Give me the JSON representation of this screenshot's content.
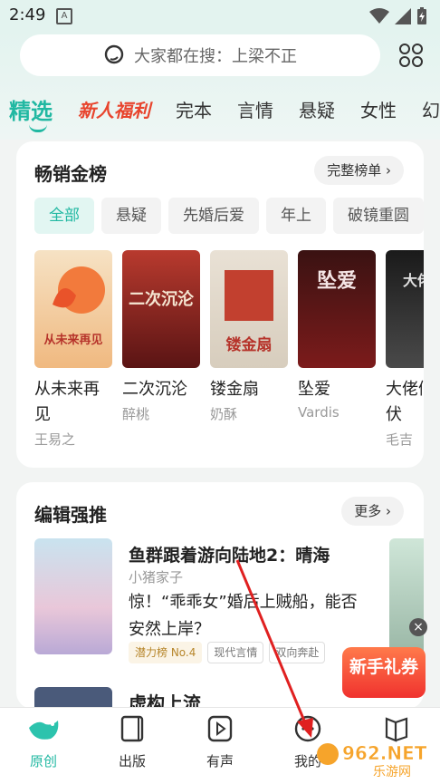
{
  "status": {
    "time": "2:49"
  },
  "search": {
    "placeholder": "大家都在搜：上梁不正"
  },
  "tabs": [
    "精选",
    "新人福利",
    "完本",
    "言情",
    "悬疑",
    "女性",
    "幻"
  ],
  "bestseller": {
    "title": "畅销金榜",
    "more": "完整榜单 ›",
    "filters": [
      "全部",
      "悬疑",
      "先婚后爱",
      "年上",
      "破镜重圆"
    ],
    "books": [
      {
        "title": "从未来再见",
        "author": "王易之",
        "cover_text": "从未来再见",
        "color": "#f2d9b5"
      },
      {
        "title": "二次沉沦",
        "author": "醉桃",
        "cover_text": "二次沉沦",
        "color": "#8b2a2a"
      },
      {
        "title": "镂金扇",
        "author": "奶酥",
        "cover_text": "镂金扇",
        "color": "#c2402f"
      },
      {
        "title": "坠爱",
        "author": "Vardis",
        "cover_text": "坠爱",
        "color": "#7c1b1b"
      },
      {
        "title": "大佬们在伏",
        "author": "毛吉",
        "cover_text": "大佬们",
        "color": "#2e2e2e"
      }
    ]
  },
  "editor": {
    "title": "编辑强推",
    "more": "更多 ›",
    "rec": {
      "title": "鱼群跟着游向陆地2：晴海",
      "author": "小猪家子",
      "desc": "惊！“乖乖女”婚后上贼船，能否安然上岸？",
      "tags": [
        "潜力榜 No.4",
        "现代言情",
        "双向奔赴"
      ]
    },
    "rec2_title": "虚构上流",
    "gift": "新手礼券",
    "gift_close": "×"
  },
  "nav": [
    {
      "label": "原创",
      "icon": "bird-icon"
    },
    {
      "label": "出版",
      "icon": "book-icon"
    },
    {
      "label": "有声",
      "icon": "play-icon"
    },
    {
      "label": "我的",
      "icon": "profile-icon"
    },
    {
      "label": "",
      "icon": "bookshelf-icon"
    }
  ],
  "watermark": "962.NET 乐游网"
}
